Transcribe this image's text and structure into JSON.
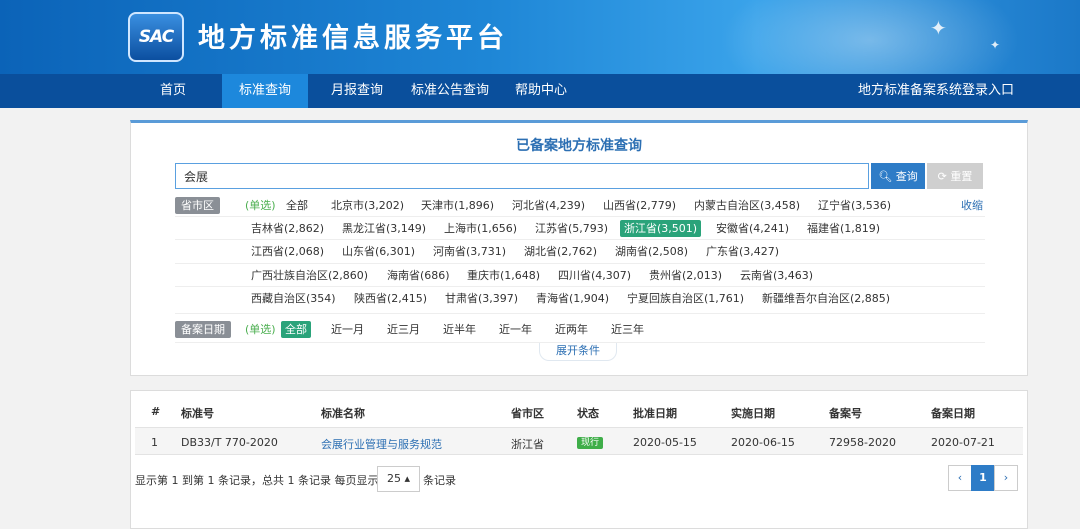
{
  "header": {
    "logo_text": "SAC",
    "site_title": "地方标准信息服务平台"
  },
  "nav": {
    "items": [
      "首页",
      "标准查询",
      "月报查询",
      "标准公告查询",
      "帮助中心"
    ],
    "right_link": "地方标准备案系统登录入口"
  },
  "search": {
    "title": "已备案地方标准查询",
    "value": "会展",
    "query_label": "查询",
    "reset_label": "重置",
    "region_label": "省市区",
    "single_hint": "(单选)",
    "collapse": "收缩",
    "regions": [
      [
        "全部",
        "北京市(3,202)",
        "天津市(1,896)",
        "河北省(4,239)",
        "山西省(2,779)",
        "内蒙古自治区(3,458)",
        "辽宁省(3,536)"
      ],
      [
        "吉林省(2,862)",
        "黑龙江省(3,149)",
        "上海市(1,656)",
        "江苏省(5,793)",
        "浙江省(3,501)",
        "安徽省(4,241)",
        "福建省(1,819)"
      ],
      [
        "江西省(2,068)",
        "山东省(6,301)",
        "河南省(3,731)",
        "湖北省(2,762)",
        "湖南省(2,508)",
        "广东省(3,427)"
      ],
      [
        "广西壮族自治区(2,860)",
        "海南省(686)",
        "重庆市(1,648)",
        "四川省(4,307)",
        "贵州省(2,013)",
        "云南省(3,463)"
      ],
      [
        "西藏自治区(354)",
        "陕西省(2,415)",
        "甘肃省(3,397)",
        "青海省(1,904)",
        "宁夏回族自治区(1,761)",
        "新疆维吾尔自治区(2,885)"
      ]
    ],
    "selected_region": "浙江省(3,501)",
    "date_label": "备案日期",
    "dates": [
      "全部",
      "近一月",
      "近三月",
      "近半年",
      "近一年",
      "近两年",
      "近三年"
    ],
    "selected_date": "全部",
    "expand": "展开条件"
  },
  "results": {
    "headers": [
      "#",
      "标准号",
      "标准名称",
      "省市区",
      "状态",
      "批准日期",
      "实施日期",
      "备案号",
      "备案日期"
    ],
    "rows": [
      {
        "idx": "1",
        "code": "DB33/T 770-2020",
        "name": "会展行业管理与服务规范",
        "region": "浙江省",
        "status": "现行",
        "approve": "2020-05-15",
        "implement": "2020-06-15",
        "record_no": "72958-2020",
        "record_date": "2020-07-21"
      }
    ],
    "summary": "显示第 1 到第 1 条记录，总共 1 条记录 每页显示",
    "page_size": "25 ▴",
    "summary_tail": "条记录",
    "pager": {
      "prev": "‹",
      "current": "1",
      "next": "›"
    }
  },
  "colors": {
    "nav_bg": "#0a4f9c",
    "nav_active": "#1d88dc",
    "selected": "#2aa37a",
    "status_green": "#3fae49"
  }
}
